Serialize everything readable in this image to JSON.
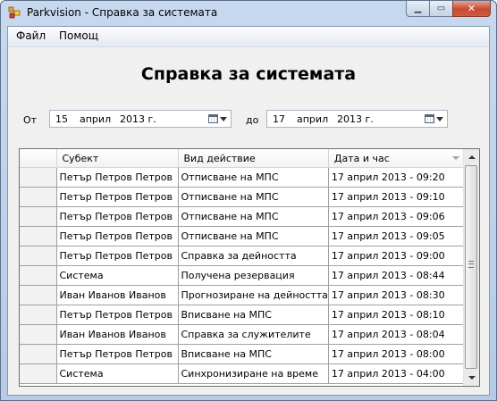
{
  "window": {
    "title": "Parkvision - Справка за системата"
  },
  "menu": {
    "items": [
      {
        "label": "Файл"
      },
      {
        "label": "Помощ"
      }
    ]
  },
  "page": {
    "title": "Справка за системата"
  },
  "filter": {
    "from_label": "От",
    "to_label": "до",
    "from_date": {
      "day": "15",
      "month": "април",
      "year": "2013 г."
    },
    "to_date": {
      "day": "17",
      "month": "април",
      "year": "2013 г."
    }
  },
  "grid": {
    "columns": [
      "Субект",
      "Вид действие",
      "Дата и час"
    ],
    "rows": [
      [
        "Петър Петров Петров",
        "Отписване на МПС",
        "17 април 2013 - 09:20"
      ],
      [
        "Петър Петров Петров",
        "Отписване на МПС",
        "17 април 2013 - 09:10"
      ],
      [
        "Петър Петров Петров",
        "Отписване на МПС",
        "17 април 2013 - 09:06"
      ],
      [
        "Петър Петров Петров",
        "Отписване на МПС",
        "17 април 2013 - 09:05"
      ],
      [
        "Петър Петров Петров",
        "Справка за дейността",
        "17 април 2013 - 09:00"
      ],
      [
        "Система",
        "Получена резервация",
        "17 април 2013 - 08:44"
      ],
      [
        "Иван Иванов Иванов",
        "Прогнозиране на дейността",
        "17 април 2013 - 08:30"
      ],
      [
        "Петър Петров Петров",
        "Вписване на МПС",
        "17 април 2013 - 08:10"
      ],
      [
        "Иван Иванов Иванов",
        "Справка за служителите",
        "17 април 2013 - 08:04"
      ],
      [
        "Петър Петров Петров",
        "Вписване на МПС",
        "17 април 2013 - 08:00"
      ],
      [
        "Система",
        "Синхронизиране на време",
        "17 април 2013 - 04:00"
      ]
    ]
  }
}
